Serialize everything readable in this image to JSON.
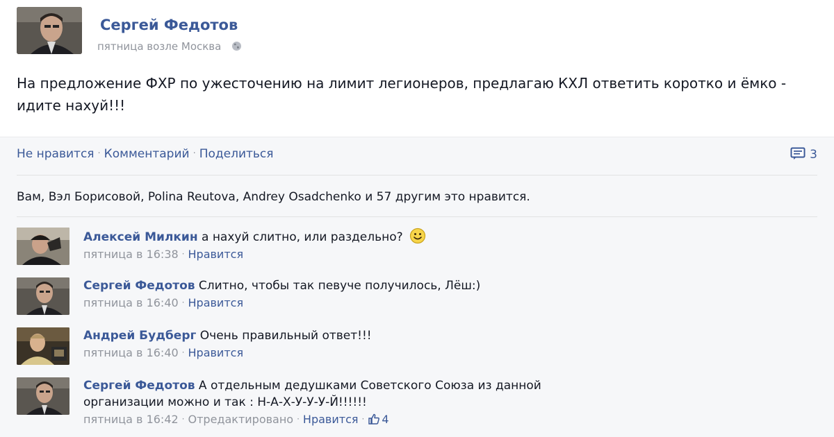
{
  "post": {
    "author": "Сергей Федотов",
    "meta": "пятница возле Москва",
    "privacy_icon": "globe-icon",
    "text": "На предложение ФХР по ужесточению на лимит легионеров, предлагаю КХЛ ответить коротко и ёмко - идите нахуй!!!"
  },
  "actions": {
    "unlike": "Не нравится",
    "comment": "Комментарий",
    "share": "Поделиться",
    "comment_count": "3",
    "comment_icon": "comment-icon"
  },
  "likes_summary": "Вам, Вэл Борисовой, Polina Reutova, Andrey Osadchenko и 57 другим это нравится.",
  "comments": [
    {
      "author": "Алексей Милкин",
      "text": "а нахуй слитно, или раздельно?",
      "time": "пятница в 16:38",
      "like_label": "Нравится",
      "emoticon": "smile-icon"
    },
    {
      "author": "Сергей Федотов",
      "text": "Слитно, чтобы так певуче получилось, Лёш:)",
      "time": "пятница в 16:40",
      "like_label": "Нравится"
    },
    {
      "author": "Андрей Будберг",
      "text": "Очень правильный ответ!!!",
      "time": "пятница в 16:40",
      "like_label": "Нравится"
    },
    {
      "author": "Сергей Федотов",
      "text_line1": "А отдельным дедушками Советского Союза из данной",
      "text_line2": "организации можно и так : Н-А-Х-У-У-У-Й!!!!!!",
      "time": "пятница в 16:42",
      "edited": "Отредактировано",
      "like_label": "Нравится",
      "like_count": "4",
      "like_icon": "thumbs-up-icon"
    }
  ],
  "colors": {
    "link": "#3b5998",
    "meta": "#90949c",
    "feedback_bg": "#f6f7f9"
  }
}
